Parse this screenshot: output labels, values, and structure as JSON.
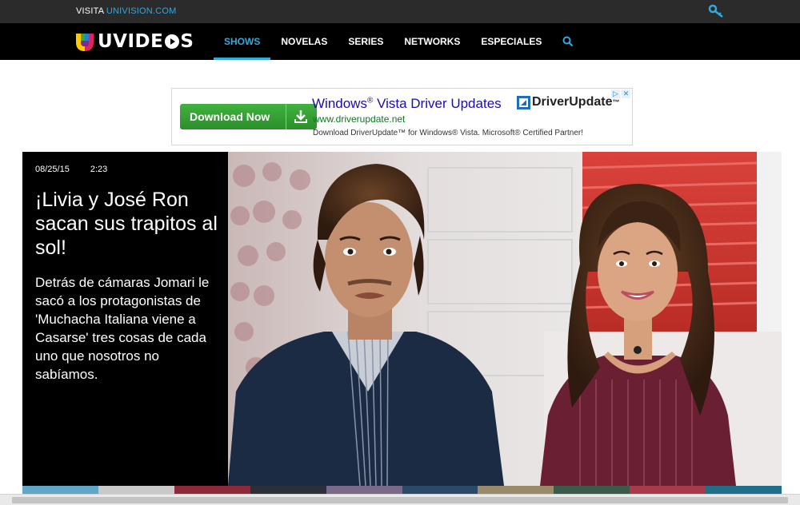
{
  "topbar": {
    "visit_prefix": "VISITA ",
    "visit_link": "UNIVISION.COM",
    "key_icon": "key-icon"
  },
  "logo": {
    "text_left": "UVIDE",
    "text_right": "S"
  },
  "nav": {
    "items": [
      {
        "label": "SHOWS",
        "active": true
      },
      {
        "label": "NOVELAS",
        "active": false
      },
      {
        "label": "SERIES",
        "active": false
      },
      {
        "label": "NETWORKS",
        "active": false
      },
      {
        "label": "ESPECIALES",
        "active": false
      }
    ],
    "search_icon": "search-icon"
  },
  "ad": {
    "button_label": "Download Now",
    "headline_part1": "Windows",
    "headline_reg": "®",
    "headline_part2": " Vista Driver Updates",
    "url": "www.driverupdate.net",
    "description": "Download DriverUpdate™ for Windows® Vista. Microsoft® Certified Partner!",
    "brand": "DriverUpdate",
    "brand_tm": "™",
    "adchoices_labels": [
      "▷",
      "✕"
    ]
  },
  "feature": {
    "date": "08/25/15",
    "duration": "2:23",
    "title": "¡Livia y José Ron sacan sus trapitos al sol!",
    "summary": "Detrás de cámaras Jomari le sacó a los protagonistas de 'Muchacha Italiana viene a Casarse' tres cosas de cada uno que nosotros no sabíamos."
  },
  "colors": {
    "accent": "#33a8e0",
    "topbar_bg": "#2b2b2b",
    "nav_bg": "#000000",
    "ad_green": "#2b8f2a"
  }
}
